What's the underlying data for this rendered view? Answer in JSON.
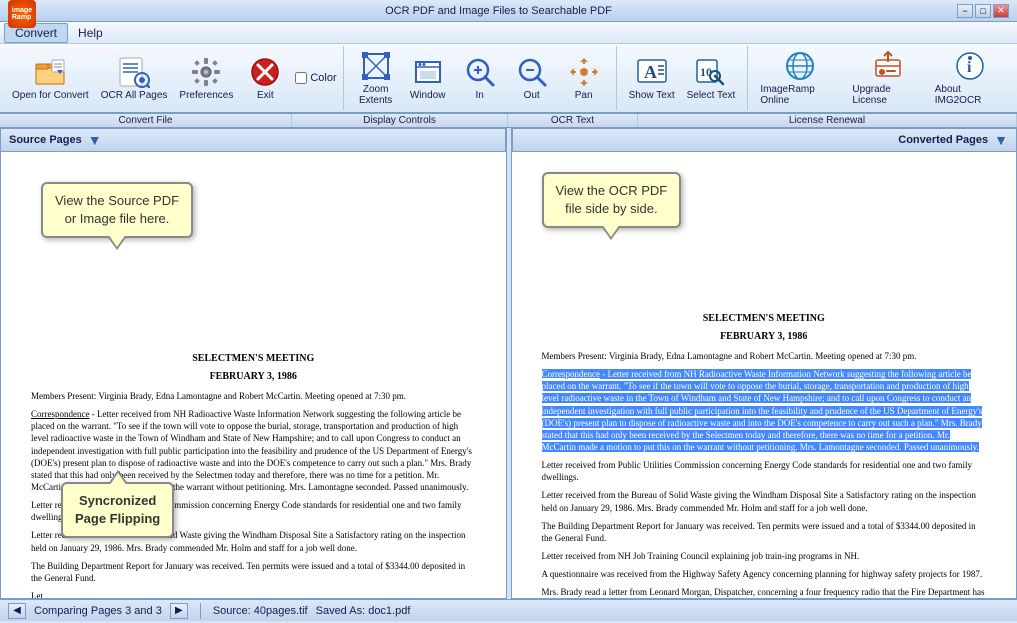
{
  "title_bar": {
    "title": "OCR PDF and Image Files to Searchable PDF",
    "min_btn": "−",
    "max_btn": "□",
    "close_btn": "✕"
  },
  "menu": {
    "convert_label": "Convert",
    "help_label": "Help"
  },
  "toolbar": {
    "open_label": "Open for Convert",
    "ocr_all_label": "OCR All Pages",
    "preferences_label": "Preferences",
    "exit_label": "Exit",
    "color_label": "Color",
    "zoom_extents_label": "Zoom\nExtents",
    "window_label": "Window",
    "in_label": "In",
    "out_label": "Out",
    "pan_label": "Pan",
    "show_text_label": "Show Text",
    "select_text_label": "Select Text",
    "imageramp_label": "ImageRamp Online",
    "upgrade_label": "Upgrade License",
    "about_label": "About IMG2OCR"
  },
  "toolbar_groups": {
    "convert_file": "Convert File",
    "display_controls": "Display Controls",
    "ocr_text": "OCR Text",
    "license_renewal": "License Renewal"
  },
  "panels": {
    "source_label": "Source Pages",
    "converted_label": "Converted Pages"
  },
  "callouts": {
    "left": "View the Source PDF\nor Image file here.",
    "right": "View the OCR PDF\nfile side by side.",
    "bottom": "Syncronized\nPage Flipping"
  },
  "document": {
    "title1": "SELECTMEN'S MEETING",
    "title2": "FEBRUARY 3, 1986",
    "body": "Members Present: Virginia Brady, Edna Lamontagne and Robert McCartin. Meeting opened at 7:30 pm.\n\nCorrespondence - Letter received from NH Radioactive Waste Information Network suggesting the following article be placed on the warrant. \"To see if the town will vote to oppose the burial, storage, transportation and production of high level radioactive waste in the Town of Windham and State of New Hampshire; and to call upon Congress to conduct an independent investigation with full public participation into the feasibility and prudence of the US Department of Energy's (DOE's) present plan to dispose of radioactive waste and into the DOE's competence to carry out such a plan.\" Mrs. Brady stated that this had only been received by the Selectmen today and therefore, there was no time for a petition. Mr. McCartin made a motion to put this on the warrant without petitioning. Mrs. Lamontagne seconded. Passed unanimously.\n\nLetter received from Public Utilities Commission concerning Energy Code standards for residential one and two family dwellings.\n\nLetter received from the Bureau of Solid Waste giving the Windham Disposal Site a Satisfactory rating on the inspection held on January 29, 1986. Mrs. Brady commended Mr. Holm and staff for a job well done.\n\nThe Building Department Report for January was received. Ten permits were issued and a total of $3344.00 deposited in the General Fund.\n\nLetter received from NH Job Training Council explaining job train-ing programs in NH.\n\nA questionnaire was received from the Highway Safety Agency concerning planning for highway safety projects for 1987.\n\nMrs. Brady read a letter from Leonard Morgan, Dispatcher, concerning a four frequency radio that the Fire Department has that he thinks would be of more use in Dispatch. The Board discussed the possibility of having Chief Mackeyof giving Dispatch the radio. Several members"
  },
  "status_bar": {
    "page_info": "Comparing Pages 3 and 3",
    "source_file": "Source: 40pages.tif",
    "saved_as": "Saved As: doc1.pdf"
  }
}
